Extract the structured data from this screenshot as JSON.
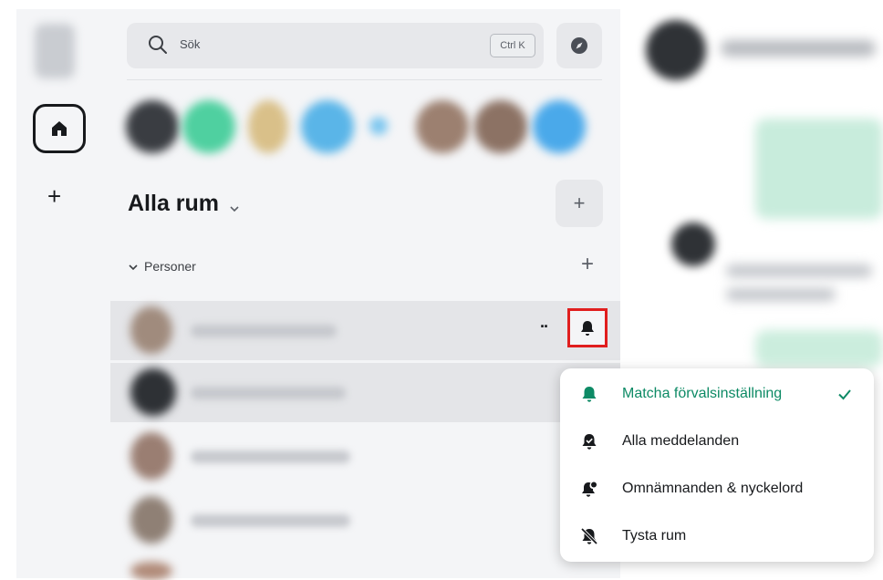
{
  "search": {
    "placeholder": "Sök",
    "shortcut": "Ctrl K"
  },
  "room_list": {
    "title": "Alla rum"
  },
  "section": {
    "label": "Personer"
  },
  "notification_menu": {
    "items": [
      {
        "label": "Matcha förvalsinställning",
        "icon": "bell-icon",
        "selected": true
      },
      {
        "label": "Alla meddelanden",
        "icon": "bell-ring-icon",
        "selected": false
      },
      {
        "label": "Omnämnanden & nyckelord",
        "icon": "bell-mention-icon",
        "selected": false
      },
      {
        "label": "Tysta rum",
        "icon": "bell-off-icon",
        "selected": false
      }
    ]
  },
  "colors": {
    "accent": "#0d8a65",
    "highlight": "#e01e1e",
    "text": "#17191c",
    "panel": "#f4f5f7"
  }
}
